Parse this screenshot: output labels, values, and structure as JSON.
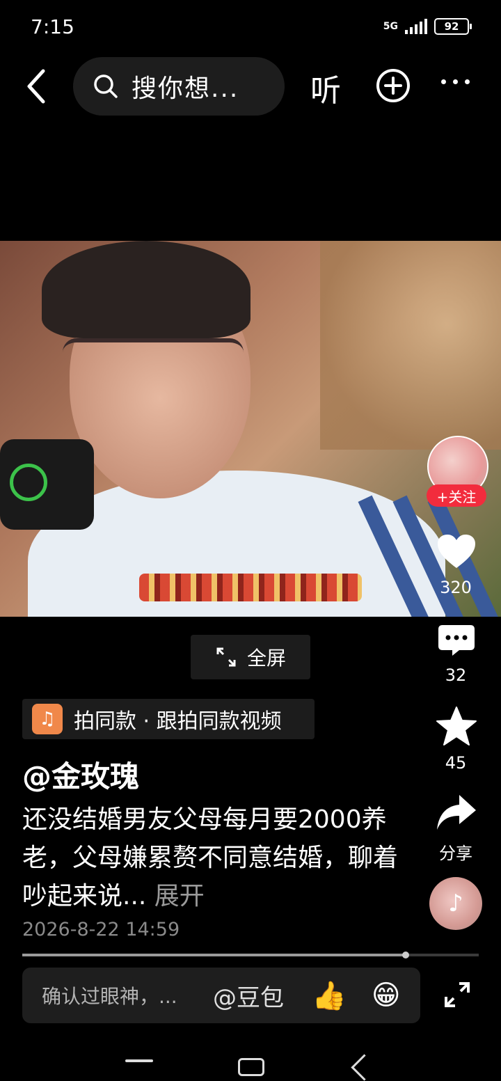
{
  "status_bar": {
    "time": "7:15",
    "network": "5G",
    "battery": "92"
  },
  "top_bar": {
    "search_placeholder": "搜你想...",
    "listen_label": "听"
  },
  "video": {
    "fullscreen_label": "全屏"
  },
  "side_actions": {
    "follow_label": "+关注",
    "like_count": "320",
    "comment_count": "32",
    "favorite_count": "45",
    "share_label": "分享"
  },
  "same_style": {
    "label": "拍同款 · 跟拍同款视频"
  },
  "post": {
    "author": "@金玫瑰",
    "description": "还没结婚男友父母每月要2000养老，父母嫌累赘不同意结婚，聊着吵起来说...",
    "expand_label": "展开",
    "date": "2026-8-22 14:59",
    "progress": 0.84
  },
  "comment_bar": {
    "placeholder": "确认过眼神，...",
    "mention": "@豆包",
    "emoji_1": "👍",
    "emoji_2": "😁"
  }
}
